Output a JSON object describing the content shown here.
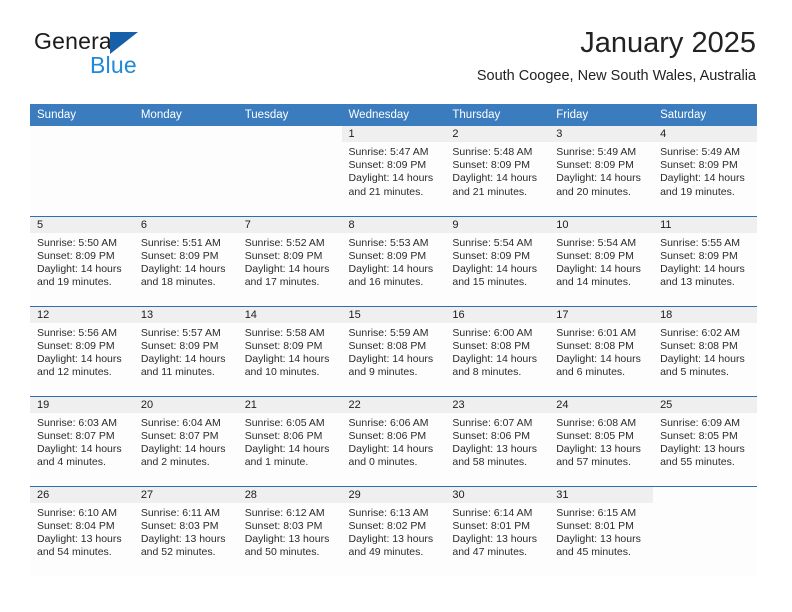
{
  "brand": {
    "name_top": "General",
    "name_bottom": "Blue",
    "triangle_color": "#1560a8",
    "blue_text_color": "#2089d8"
  },
  "header": {
    "title": "January 2025",
    "subtitle": "South Coogee, New South Wales, Australia",
    "header_bg_color": "#3a7cbe",
    "grid_line_color": "#2f6fae",
    "daynum_band_color": "#efefef"
  },
  "weekday_headers": [
    "Sunday",
    "Monday",
    "Tuesday",
    "Wednesday",
    "Thursday",
    "Friday",
    "Saturday"
  ],
  "labels": {
    "sunrise_prefix": "Sunrise:",
    "sunset_prefix": "Sunset:",
    "daylight_prefix": "Daylight:"
  },
  "weeks": [
    [
      {
        "day": "",
        "blank": true
      },
      {
        "day": "",
        "blank": true
      },
      {
        "day": "",
        "blank": true
      },
      {
        "day": "1",
        "sunrise": "Sunrise: 5:47 AM",
        "sunset": "Sunset: 8:09 PM",
        "daylight_l1": "Daylight: 14 hours",
        "daylight_l2": "and 21 minutes."
      },
      {
        "day": "2",
        "sunrise": "Sunrise: 5:48 AM",
        "sunset": "Sunset: 8:09 PM",
        "daylight_l1": "Daylight: 14 hours",
        "daylight_l2": "and 21 minutes."
      },
      {
        "day": "3",
        "sunrise": "Sunrise: 5:49 AM",
        "sunset": "Sunset: 8:09 PM",
        "daylight_l1": "Daylight: 14 hours",
        "daylight_l2": "and 20 minutes."
      },
      {
        "day": "4",
        "sunrise": "Sunrise: 5:49 AM",
        "sunset": "Sunset: 8:09 PM",
        "daylight_l1": "Daylight: 14 hours",
        "daylight_l2": "and 19 minutes."
      }
    ],
    [
      {
        "day": "5",
        "sunrise": "Sunrise: 5:50 AM",
        "sunset": "Sunset: 8:09 PM",
        "daylight_l1": "Daylight: 14 hours",
        "daylight_l2": "and 19 minutes."
      },
      {
        "day": "6",
        "sunrise": "Sunrise: 5:51 AM",
        "sunset": "Sunset: 8:09 PM",
        "daylight_l1": "Daylight: 14 hours",
        "daylight_l2": "and 18 minutes."
      },
      {
        "day": "7",
        "sunrise": "Sunrise: 5:52 AM",
        "sunset": "Sunset: 8:09 PM",
        "daylight_l1": "Daylight: 14 hours",
        "daylight_l2": "and 17 minutes."
      },
      {
        "day": "8",
        "sunrise": "Sunrise: 5:53 AM",
        "sunset": "Sunset: 8:09 PM",
        "daylight_l1": "Daylight: 14 hours",
        "daylight_l2": "and 16 minutes."
      },
      {
        "day": "9",
        "sunrise": "Sunrise: 5:54 AM",
        "sunset": "Sunset: 8:09 PM",
        "daylight_l1": "Daylight: 14 hours",
        "daylight_l2": "and 15 minutes."
      },
      {
        "day": "10",
        "sunrise": "Sunrise: 5:54 AM",
        "sunset": "Sunset: 8:09 PM",
        "daylight_l1": "Daylight: 14 hours",
        "daylight_l2": "and 14 minutes."
      },
      {
        "day": "11",
        "sunrise": "Sunrise: 5:55 AM",
        "sunset": "Sunset: 8:09 PM",
        "daylight_l1": "Daylight: 14 hours",
        "daylight_l2": "and 13 minutes."
      }
    ],
    [
      {
        "day": "12",
        "sunrise": "Sunrise: 5:56 AM",
        "sunset": "Sunset: 8:09 PM",
        "daylight_l1": "Daylight: 14 hours",
        "daylight_l2": "and 12 minutes."
      },
      {
        "day": "13",
        "sunrise": "Sunrise: 5:57 AM",
        "sunset": "Sunset: 8:09 PM",
        "daylight_l1": "Daylight: 14 hours",
        "daylight_l2": "and 11 minutes."
      },
      {
        "day": "14",
        "sunrise": "Sunrise: 5:58 AM",
        "sunset": "Sunset: 8:09 PM",
        "daylight_l1": "Daylight: 14 hours",
        "daylight_l2": "and 10 minutes."
      },
      {
        "day": "15",
        "sunrise": "Sunrise: 5:59 AM",
        "sunset": "Sunset: 8:08 PM",
        "daylight_l1": "Daylight: 14 hours",
        "daylight_l2": "and 9 minutes."
      },
      {
        "day": "16",
        "sunrise": "Sunrise: 6:00 AM",
        "sunset": "Sunset: 8:08 PM",
        "daylight_l1": "Daylight: 14 hours",
        "daylight_l2": "and 8 minutes."
      },
      {
        "day": "17",
        "sunrise": "Sunrise: 6:01 AM",
        "sunset": "Sunset: 8:08 PM",
        "daylight_l1": "Daylight: 14 hours",
        "daylight_l2": "and 6 minutes."
      },
      {
        "day": "18",
        "sunrise": "Sunrise: 6:02 AM",
        "sunset": "Sunset: 8:08 PM",
        "daylight_l1": "Daylight: 14 hours",
        "daylight_l2": "and 5 minutes."
      }
    ],
    [
      {
        "day": "19",
        "sunrise": "Sunrise: 6:03 AM",
        "sunset": "Sunset: 8:07 PM",
        "daylight_l1": "Daylight: 14 hours",
        "daylight_l2": "and 4 minutes."
      },
      {
        "day": "20",
        "sunrise": "Sunrise: 6:04 AM",
        "sunset": "Sunset: 8:07 PM",
        "daylight_l1": "Daylight: 14 hours",
        "daylight_l2": "and 2 minutes."
      },
      {
        "day": "21",
        "sunrise": "Sunrise: 6:05 AM",
        "sunset": "Sunset: 8:06 PM",
        "daylight_l1": "Daylight: 14 hours",
        "daylight_l2": "and 1 minute."
      },
      {
        "day": "22",
        "sunrise": "Sunrise: 6:06 AM",
        "sunset": "Sunset: 8:06 PM",
        "daylight_l1": "Daylight: 14 hours",
        "daylight_l2": "and 0 minutes."
      },
      {
        "day": "23",
        "sunrise": "Sunrise: 6:07 AM",
        "sunset": "Sunset: 8:06 PM",
        "daylight_l1": "Daylight: 13 hours",
        "daylight_l2": "and 58 minutes."
      },
      {
        "day": "24",
        "sunrise": "Sunrise: 6:08 AM",
        "sunset": "Sunset: 8:05 PM",
        "daylight_l1": "Daylight: 13 hours",
        "daylight_l2": "and 57 minutes."
      },
      {
        "day": "25",
        "sunrise": "Sunrise: 6:09 AM",
        "sunset": "Sunset: 8:05 PM",
        "daylight_l1": "Daylight: 13 hours",
        "daylight_l2": "and 55 minutes."
      }
    ],
    [
      {
        "day": "26",
        "sunrise": "Sunrise: 6:10 AM",
        "sunset": "Sunset: 8:04 PM",
        "daylight_l1": "Daylight: 13 hours",
        "daylight_l2": "and 54 minutes."
      },
      {
        "day": "27",
        "sunrise": "Sunrise: 6:11 AM",
        "sunset": "Sunset: 8:03 PM",
        "daylight_l1": "Daylight: 13 hours",
        "daylight_l2": "and 52 minutes."
      },
      {
        "day": "28",
        "sunrise": "Sunrise: 6:12 AM",
        "sunset": "Sunset: 8:03 PM",
        "daylight_l1": "Daylight: 13 hours",
        "daylight_l2": "and 50 minutes."
      },
      {
        "day": "29",
        "sunrise": "Sunrise: 6:13 AM",
        "sunset": "Sunset: 8:02 PM",
        "daylight_l1": "Daylight: 13 hours",
        "daylight_l2": "and 49 minutes."
      },
      {
        "day": "30",
        "sunrise": "Sunrise: 6:14 AM",
        "sunset": "Sunset: 8:01 PM",
        "daylight_l1": "Daylight: 13 hours",
        "daylight_l2": "and 47 minutes."
      },
      {
        "day": "31",
        "sunrise": "Sunrise: 6:15 AM",
        "sunset": "Sunset: 8:01 PM",
        "daylight_l1": "Daylight: 13 hours",
        "daylight_l2": "and 45 minutes."
      },
      {
        "day": "",
        "blank": true
      }
    ]
  ]
}
